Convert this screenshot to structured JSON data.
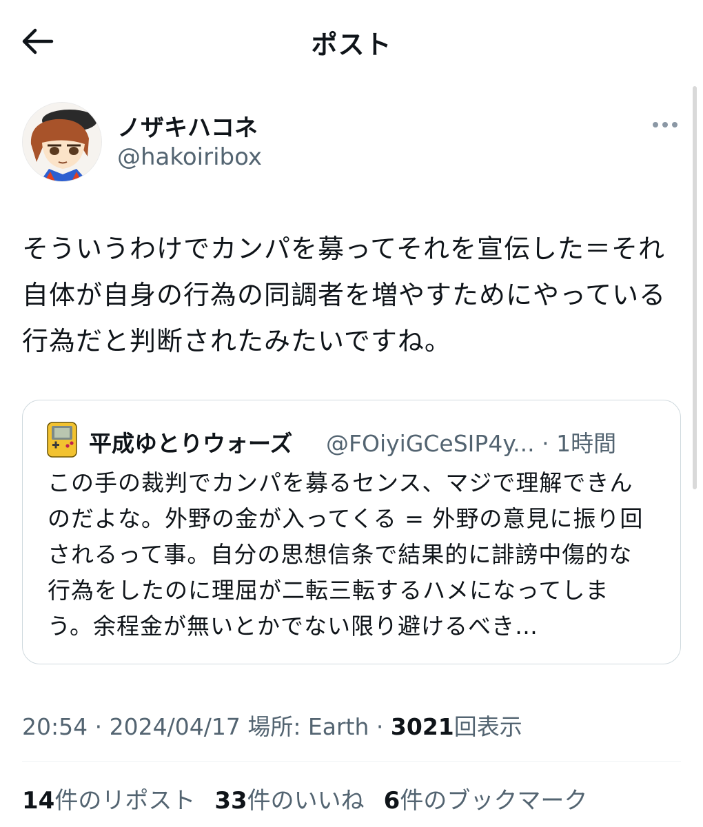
{
  "header": {
    "title": "ポスト",
    "back_icon": "arrow-left-icon"
  },
  "author": {
    "name": "ノザキハコネ",
    "handle": "@hakoiribox",
    "avatar_icon": "user-avatar"
  },
  "post": {
    "text": "そういうわけでカンパを募ってそれを宣伝した＝それ自体が自身の行為の同調者を増やすためにやっている行為だと判断されたみたいですね。"
  },
  "quote": {
    "name": "平成ゆとりウォーズ",
    "handle": "@FOiyiGCeSIP4y...",
    "separator": "·",
    "time": "1時間",
    "text": "この手の裁判でカンパを募るセンス、マジで理解できんのだよな。外野の金が入ってくる = 外野の意見に振り回されるって事。自分の思想信条で結果的に誹謗中傷的な行為をしたのに理屈が二転三転するハメになってしまう。余程金が無いとかでない限り避けるべき…"
  },
  "meta": {
    "time": "20:54",
    "date": "2024/04/17",
    "dot": "·",
    "location": "場所: Earth",
    "views": "3021",
    "views_label": "回表示"
  },
  "stats": {
    "reposts_count": "14",
    "reposts_label": "件のリポスト",
    "likes_count": "33",
    "likes_label": "件のいいね",
    "bookmarks_count": "6",
    "bookmarks_label": "件のブックマーク"
  },
  "colors": {
    "text": "#0f1419",
    "secondary": "#536471",
    "border": "#cfd9de"
  }
}
